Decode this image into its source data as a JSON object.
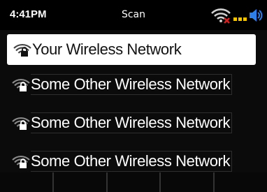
{
  "status_bar": {
    "time": "4:41PM",
    "title": "Scan",
    "wifi_icon": "wifi-disconnected-icon",
    "volume_icon": "speaker-volume-icon",
    "accent_color": "#f4c400",
    "error_color": "#d21f1f",
    "volume_color": "#2f7fe8"
  },
  "networks": [
    {
      "ssid": "Your Wireless Network",
      "secured": true,
      "selected": true
    },
    {
      "ssid": "Some Other Wireless Network",
      "secured": true,
      "selected": false
    },
    {
      "ssid": "Some Other Wireless Network",
      "secured": true,
      "selected": false
    },
    {
      "ssid": "Some Other Wireless Network",
      "secured": true,
      "selected": false
    }
  ],
  "softkeys": [
    "",
    "",
    "",
    "",
    ""
  ]
}
